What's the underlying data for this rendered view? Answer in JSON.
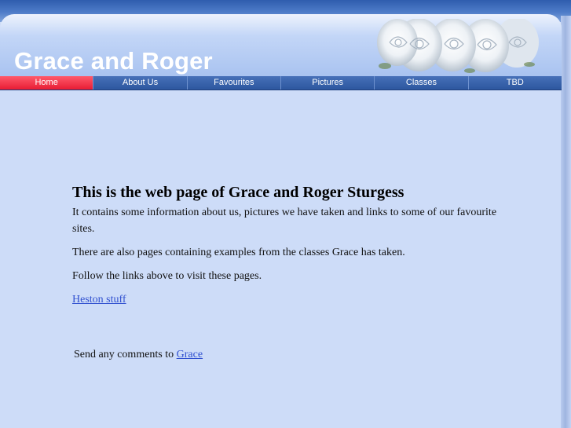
{
  "site": {
    "title": "Grace and Roger"
  },
  "nav": {
    "items": [
      {
        "label": "Home",
        "active": true
      },
      {
        "label": "About Us",
        "active": false
      },
      {
        "label": "Favourites",
        "active": false
      },
      {
        "label": "Pictures",
        "active": false
      },
      {
        "label": "Classes",
        "active": false
      },
      {
        "label": "TBD",
        "active": false
      }
    ]
  },
  "main": {
    "heading": "This is the web page of Grace and Roger Sturgess",
    "paragraphs": [
      "It contains some information about us, pictures we have taken and links to some of our favourite sites.",
      "There are also pages containing examples from the classes Grace has taken.",
      "Follow the links above to visit these pages."
    ],
    "heston_link": "Heston stuff"
  },
  "footer": {
    "text": "Send any comments to ",
    "link": "Grace"
  },
  "colors": {
    "nav_active": "#e81c34",
    "nav_background": "#2e5aa6",
    "page_background": "#cddcf8",
    "link": "#3050d0"
  },
  "icons": {
    "header_decoration": "white-roses-image"
  }
}
